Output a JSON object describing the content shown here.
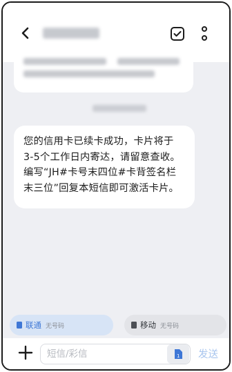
{
  "header": {
    "back_icon": "back-arrow-icon",
    "sender_blurred": true,
    "check_icon": "select-check-icon",
    "more_icon": "more-vertical-icon"
  },
  "messages": [
    {
      "blurred": true
    },
    {
      "text": "您的信用卡已续卡成功，卡片将于\n3-5个工作日内寄达，请留意查收。\n编写“JH#卡号末四位#卡背签名栏\n末三位”回复本短信即可激活卡片。"
    }
  ],
  "sim_selector": [
    {
      "name": "联通",
      "status": "无号码",
      "color": "#3e77d6",
      "selected": true
    },
    {
      "name": "移动",
      "status": "无号码",
      "color": "#4c4f55",
      "selected": false
    }
  ],
  "compose": {
    "placeholder": "短信/彩信",
    "send_label": "发送",
    "plus_icon": "plus-icon",
    "attach_icon": "sim-card-icon"
  },
  "colors": {
    "accent": "#3e77d6",
    "send_disabled": "#a8c5ee",
    "background": "#eeeff3"
  }
}
